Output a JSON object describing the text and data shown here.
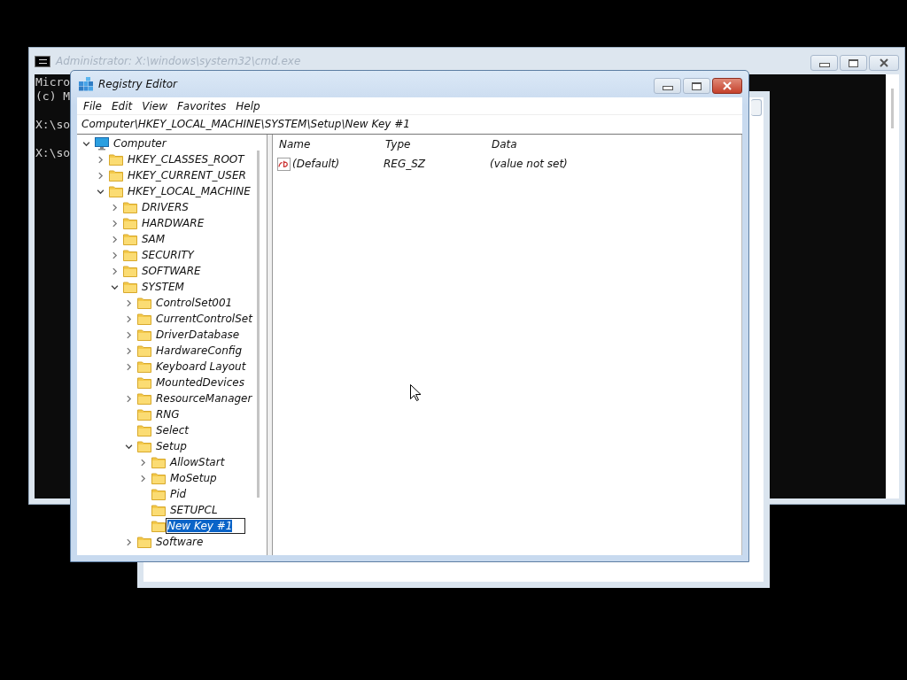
{
  "cmd_window": {
    "title": "Administrator: X:\\windows\\system32\\cmd.exe",
    "active": false,
    "lines": [
      {
        "kind": "output",
        "text": "Micro"
      },
      {
        "kind": "output",
        "text": "(c) M"
      },
      {
        "kind": "prompt",
        "text": "X:\\so"
      },
      {
        "kind": "prompt",
        "text": "X:\\so"
      }
    ]
  },
  "regedit": {
    "title": "Registry Editor",
    "active": true,
    "menu": [
      "File",
      "Edit",
      "View",
      "Favorites",
      "Help"
    ],
    "address": "Computer\\HKEY_LOCAL_MACHINE\\SYSTEM\\Setup\\New Key #1",
    "tree": [
      {
        "label": "Computer",
        "kind": "computer",
        "expanded": true,
        "selected": false,
        "children": [
          {
            "label": "HKEY_CLASSES_ROOT",
            "kind": "folder",
            "expanded": false,
            "selected": false
          },
          {
            "label": "HKEY_CURRENT_USER",
            "kind": "folder",
            "expanded": false,
            "selected": false
          },
          {
            "label": "HKEY_LOCAL_MACHINE",
            "kind": "folder",
            "expanded": true,
            "selected": false,
            "children": [
              {
                "label": "DRIVERS",
                "kind": "folder",
                "expanded": false,
                "selected": false
              },
              {
                "label": "HARDWARE",
                "kind": "folder",
                "expanded": false,
                "selected": false
              },
              {
                "label": "SAM",
                "kind": "folder",
                "expanded": false,
                "selected": false
              },
              {
                "label": "SECURITY",
                "kind": "folder",
                "expanded": false,
                "selected": false
              },
              {
                "label": "SOFTWARE",
                "kind": "folder",
                "expanded": false,
                "selected": false
              },
              {
                "label": "SYSTEM",
                "kind": "folder",
                "expanded": true,
                "selected": false,
                "children": [
                  {
                    "label": "ControlSet001",
                    "kind": "folder",
                    "expanded": false,
                    "selected": false
                  },
                  {
                    "label": "CurrentControlSet",
                    "kind": "folder",
                    "expanded": false,
                    "selected": false
                  },
                  {
                    "label": "DriverDatabase",
                    "kind": "folder",
                    "expanded": false,
                    "selected": false
                  },
                  {
                    "label": "HardwareConfig",
                    "kind": "folder",
                    "expanded": false,
                    "selected": false
                  },
                  {
                    "label": "Keyboard Layout",
                    "kind": "folder",
                    "expanded": false,
                    "selected": false
                  },
                  {
                    "label": "MountedDevices",
                    "kind": "folder",
                    "selected": false
                  },
                  {
                    "label": "ResourceManager",
                    "kind": "folder",
                    "expanded": false,
                    "selected": false
                  },
                  {
                    "label": "RNG",
                    "kind": "folder",
                    "selected": false
                  },
                  {
                    "label": "Select",
                    "kind": "folder",
                    "selected": false
                  },
                  {
                    "label": "Setup",
                    "kind": "folder",
                    "expanded": true,
                    "selected": false,
                    "children": [
                      {
                        "label": "AllowStart",
                        "kind": "folder",
                        "expanded": false,
                        "selected": false
                      },
                      {
                        "label": "MoSetup",
                        "kind": "folder",
                        "expanded": false,
                        "selected": false
                      },
                      {
                        "label": "Pid",
                        "kind": "folder",
                        "selected": false
                      },
                      {
                        "label": "SETUPCL",
                        "kind": "folder",
                        "selected": false
                      },
                      {
                        "label": "New Key #1",
                        "kind": "folder",
                        "selected": true
                      }
                    ]
                  },
                  {
                    "label": "Software",
                    "kind": "folder",
                    "expanded": false,
                    "selected": false
                  }
                ]
              }
            ]
          }
        ]
      }
    ],
    "columns": [
      "Name",
      "Type",
      "Data"
    ],
    "values": [
      {
        "name": "(Default)",
        "type": "REG_SZ",
        "data": "(value not set)"
      }
    ]
  }
}
